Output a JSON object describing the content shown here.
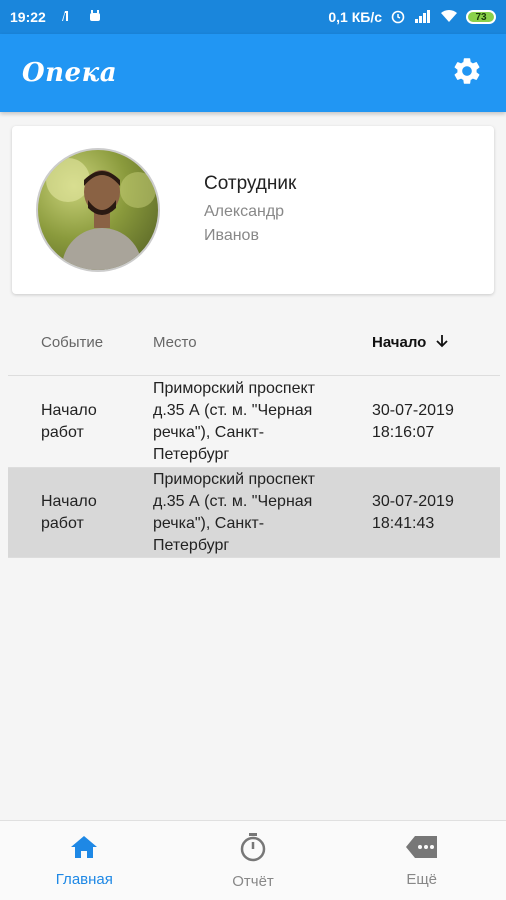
{
  "status_bar": {
    "time": "19:22",
    "network_speed": "0,1 КБ/с",
    "battery": "73"
  },
  "app_bar": {
    "title": "Опека",
    "settings_icon": "gear-icon"
  },
  "profile": {
    "role": "Сотрудник",
    "first_name": "Александр",
    "last_name": "Иванов"
  },
  "table": {
    "headers": {
      "event": "Событие",
      "place": "Место",
      "start": "Начало"
    },
    "rows": [
      {
        "event_line1": "Начало",
        "event_line2": "работ",
        "place_line1": "Приморский проспект",
        "place_line2": "д.35 А (ст. м. \"Черная",
        "place_line3": "речка\"), Санкт-",
        "place_line4": "Петербург",
        "date": "30-07-2019",
        "time": "18:16:07"
      },
      {
        "event_line1": "Начало",
        "event_line2": "работ",
        "place_line1": "Приморский проспект",
        "place_line2": "д.35 А (ст. м. \"Черная",
        "place_line3": "речка\"), Санкт-",
        "place_line4": "Петербург",
        "date": "30-07-2019",
        "time": "18:41:43"
      }
    ]
  },
  "bottom_nav": {
    "home": "Главная",
    "report": "Отчёт",
    "more": "Ещё"
  },
  "colors": {
    "primary": "#2196f3",
    "status_bar": "#1a86dc",
    "active_nav": "#1e88e5"
  }
}
